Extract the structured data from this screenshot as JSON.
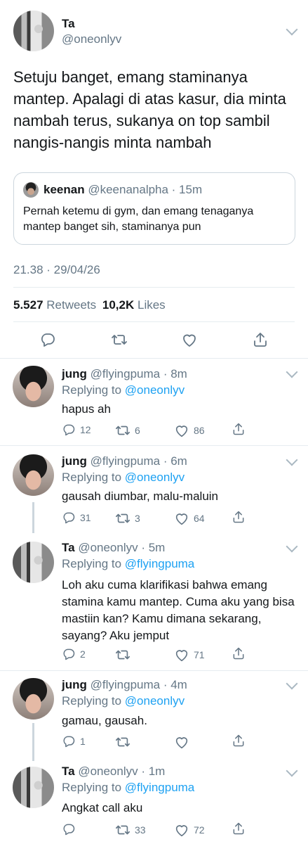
{
  "main_tweet": {
    "name": "Ta",
    "handle": "@oneonlyv",
    "text": "Setuju banget, emang staminanya mantep. Apalagi di atas kasur, dia minta nambah terus, sukanya on top sambil nangis-nangis minta nambah",
    "quote": {
      "name": "keenan",
      "handle_time": "@keenanalpha · 15m",
      "text": "Pernah ketemu di gym, dan emang tenaganya mantep banget sih, staminanya pun"
    },
    "timestamp": "21.38 · 29/04/26",
    "retweets_count": "5.527",
    "retweets_label": "Retweets",
    "likes_count": "10,2K",
    "likes_label": "Likes"
  },
  "replies": [
    {
      "name": "jung",
      "handle_time": "@flyingpuma · 8m",
      "replying_label": "Replying to",
      "replying_to": "@oneonlyv",
      "text": "hapus ah",
      "reply_count": "12",
      "retweet_count": "6",
      "like_count": "86"
    },
    {
      "name": "jung",
      "handle_time": "@flyingpuma · 6m",
      "replying_label": "Replying to",
      "replying_to": "@oneonlyv",
      "text": "gausah diumbar, malu-maluin",
      "reply_count": "31",
      "retweet_count": "3",
      "like_count": "64"
    },
    {
      "name": "Ta",
      "handle_time": "@oneonlyv · 5m",
      "replying_label": "Replying to",
      "replying_to": "@flyingpuma",
      "text": "Loh aku cuma klarifikasi bahwa emang stamina kamu mantep. Cuma aku yang bisa mastiin kan? Kamu dimana sekarang, sayang? Aku jemput",
      "reply_count": "2",
      "retweet_count": "",
      "like_count": "71"
    },
    {
      "name": "jung",
      "handle_time": "@flyingpuma · 4m",
      "replying_label": "Replying to",
      "replying_to": "@oneonlyv",
      "text": "gamau, gausah.",
      "reply_count": "1",
      "retweet_count": "",
      "like_count": ""
    },
    {
      "name": "Ta",
      "handle_time": "@oneonlyv · 1m",
      "replying_label": "Replying to",
      "replying_to": "@flyingpuma",
      "text": "Angkat call aku",
      "reply_count": "",
      "retweet_count": "33",
      "like_count": "72"
    }
  ]
}
